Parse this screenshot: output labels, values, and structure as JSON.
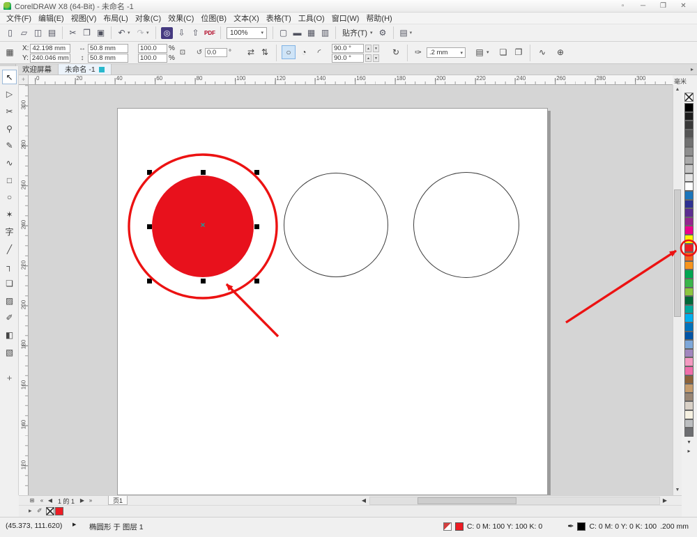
{
  "window": {
    "title": "CorelDRAW X8 (64-Bit) - 未命名 -1",
    "controls": [
      {
        "name": "app-options-icon",
        "glyph": "▫"
      },
      {
        "name": "minimize-button",
        "glyph": "─"
      },
      {
        "name": "maximize-button",
        "glyph": "❐"
      },
      {
        "name": "close-button",
        "glyph": "✕"
      }
    ]
  },
  "menu": {
    "items": [
      "文件(F)",
      "编辑(E)",
      "视图(V)",
      "布局(L)",
      "对象(C)",
      "效果(C)",
      "位图(B)",
      "文本(X)",
      "表格(T)",
      "工具(O)",
      "窗口(W)",
      "帮助(H)"
    ]
  },
  "toolbar": {
    "items": [
      {
        "name": "new-document-button",
        "glyph": "▯"
      },
      {
        "name": "open-document-button",
        "glyph": "▱"
      },
      {
        "name": "save-document-button",
        "glyph": "◫"
      },
      {
        "name": "print-button",
        "glyph": "▤"
      },
      {
        "name": "separator",
        "type": "sep"
      },
      {
        "name": "cut-button",
        "glyph": "✂"
      },
      {
        "name": "copy-button",
        "glyph": "❐"
      },
      {
        "name": "paste-button",
        "glyph": "▣"
      },
      {
        "name": "separator",
        "type": "sep"
      },
      {
        "name": "undo-button",
        "glyph": "↶",
        "dropdown": true
      },
      {
        "name": "redo-button",
        "glyph": "↷",
        "dropdown": true,
        "disabled": true
      },
      {
        "name": "separator",
        "type": "sep"
      },
      {
        "name": "search-content-button",
        "glyph": "◎",
        "accent": true
      },
      {
        "name": "import-button",
        "glyph": "⇩"
      },
      {
        "name": "export-button",
        "glyph": "⇧"
      },
      {
        "name": "publish-pdf-button",
        "glyph": "PDF",
        "type": "texticon"
      },
      {
        "name": "separator",
        "type": "sep"
      },
      {
        "name": "zoom-level-select",
        "type": "select",
        "value": "100%"
      },
      {
        "name": "separator",
        "type": "sep"
      },
      {
        "name": "full-screen-preview-button",
        "glyph": "▢"
      },
      {
        "name": "show-rulers-button",
        "glyph": "▬"
      },
      {
        "name": "show-grid-button",
        "glyph": "▦"
      },
      {
        "name": "show-guidelines-button",
        "glyph": "▥"
      },
      {
        "name": "separator",
        "type": "sep"
      },
      {
        "name": "snap-to-dropdown",
        "label": "贴齐(T)",
        "type": "textdd"
      },
      {
        "name": "options-button",
        "glyph": "⚙"
      },
      {
        "name": "separator",
        "type": "sep"
      },
      {
        "name": "application-launcher-dropdown",
        "glyph": "▤",
        "dropdown": true
      }
    ]
  },
  "property_bar": {
    "x_label": "X:",
    "x_value": "42.198 mm",
    "y_label": "Y:",
    "y_value": "240.046 mm",
    "width_value": "50.8 mm",
    "height_value": "50.8 mm",
    "scale_x_value": "100.0",
    "scale_y_value": "100.0",
    "percent": "%",
    "rotation_value": "0.0",
    "degree": "°",
    "ellipse_glyph": "○",
    "pie_glyph": "◔",
    "arc_glyph": "◜",
    "pie_start_value": "90.0 °",
    "pie_end_value": "90.0 °",
    "outline_width_value": ".2 mm"
  },
  "tabs": {
    "welcome_label": "欢迎屏幕",
    "document_label": "未命名 -1"
  },
  "rulers": {
    "h_labels": [
      "0",
      "20",
      "40",
      "60",
      "80",
      "100",
      "120",
      "140",
      "160",
      "180",
      "200",
      "220",
      "240",
      "260",
      "280",
      "300"
    ],
    "v_labels": [
      "300",
      "280",
      "260",
      "240",
      "220",
      "200",
      "180",
      "160",
      "140",
      "120"
    ],
    "units_label": "毫米"
  },
  "toolbox": {
    "tools": [
      {
        "name": "pick-tool",
        "glyph": "↖",
        "active": true
      },
      {
        "name": "shape-tool",
        "glyph": "▷"
      },
      {
        "name": "crop-tool",
        "glyph": "✂"
      },
      {
        "name": "zoom-tool",
        "glyph": "⚲"
      },
      {
        "name": "freehand-tool",
        "glyph": "✎"
      },
      {
        "name": "artistic-media-tool",
        "glyph": "∿"
      },
      {
        "name": "rectangle-tool",
        "glyph": "□"
      },
      {
        "name": "ellipse-tool",
        "glyph": "○"
      },
      {
        "name": "polygon-tool",
        "glyph": "✶"
      },
      {
        "name": "text-tool",
        "glyph": "字"
      },
      {
        "name": "parallel-dimension-tool",
        "glyph": "╱"
      },
      {
        "name": "connector-tool",
        "glyph": "┐"
      },
      {
        "name": "drop-shadow-tool",
        "glyph": "❏"
      },
      {
        "name": "transparency-tool",
        "glyph": "▨"
      },
      {
        "name": "color-eyedropper-tool",
        "glyph": "✐"
      },
      {
        "name": "interactive-fill-tool",
        "glyph": "◧"
      },
      {
        "name": "smart-fill-tool",
        "glyph": "▧"
      }
    ],
    "customize_label": "+"
  },
  "palette": {
    "colors": [
      "#000000",
      "#1c1c1c",
      "#383838",
      "#555555",
      "#717171",
      "#8e8e8e",
      "#aaaaaa",
      "#c6c6c6",
      "#e3e3e3",
      "#ffffff",
      "#1b75bb",
      "#2e3192",
      "#5c2d91",
      "#93268f",
      "#ec008c",
      "#fff200",
      "#ed1c24",
      "#f26522",
      "#f7941d",
      "#00a651",
      "#39b54a",
      "#8dc63f",
      "#006838",
      "#00a99d",
      "#00aeef",
      "#0072bc",
      "#0054a6",
      "#7da7d9",
      "#a186be",
      "#f49ac1",
      "#f06eaa",
      "#8c6239",
      "#c69c6d",
      "#998675",
      "#d9d1c7",
      "#f5f0e1",
      "#bcbec0",
      "#6d6e71"
    ],
    "highlighted_index": 16
  },
  "canvas": {
    "objects": [
      {
        "name": "selected-ellipse",
        "type": "ellipse",
        "fill_color": "#e8111c",
        "selected": true
      },
      {
        "name": "ellipse-2",
        "type": "ellipse",
        "fill_color": "none"
      },
      {
        "name": "ellipse-3",
        "type": "ellipse",
        "fill_color": "none"
      }
    ]
  },
  "page_nav": {
    "items": [
      {
        "name": "page-navigator-button",
        "glyph": "⊞"
      },
      {
        "name": "first-page-button",
        "glyph": "«"
      },
      {
        "name": "previous-page-button",
        "glyph": "◀"
      },
      {
        "name": "page-info",
        "text": "1 的 1"
      },
      {
        "name": "next-page-button",
        "glyph": "▶"
      },
      {
        "name": "last-page-button",
        "glyph": "»"
      }
    ],
    "page_tab_label": "页1"
  },
  "status": {
    "cursor_position": "(45.373, 111.620)",
    "object_info": "椭圆形 于 图层 1",
    "fill_color_text": "C: 0 M: 100 Y: 100 K: 0",
    "outline_color_text": "C: 0 M: 0 Y: 0 K: 100",
    "outline_width_text": ".200 mm"
  },
  "colors": {
    "shape_fill_red": "#e8111c",
    "annotation_red": "#ec1212",
    "fill_swatch": "#ed1c24",
    "outline_swatch": "#000000"
  }
}
